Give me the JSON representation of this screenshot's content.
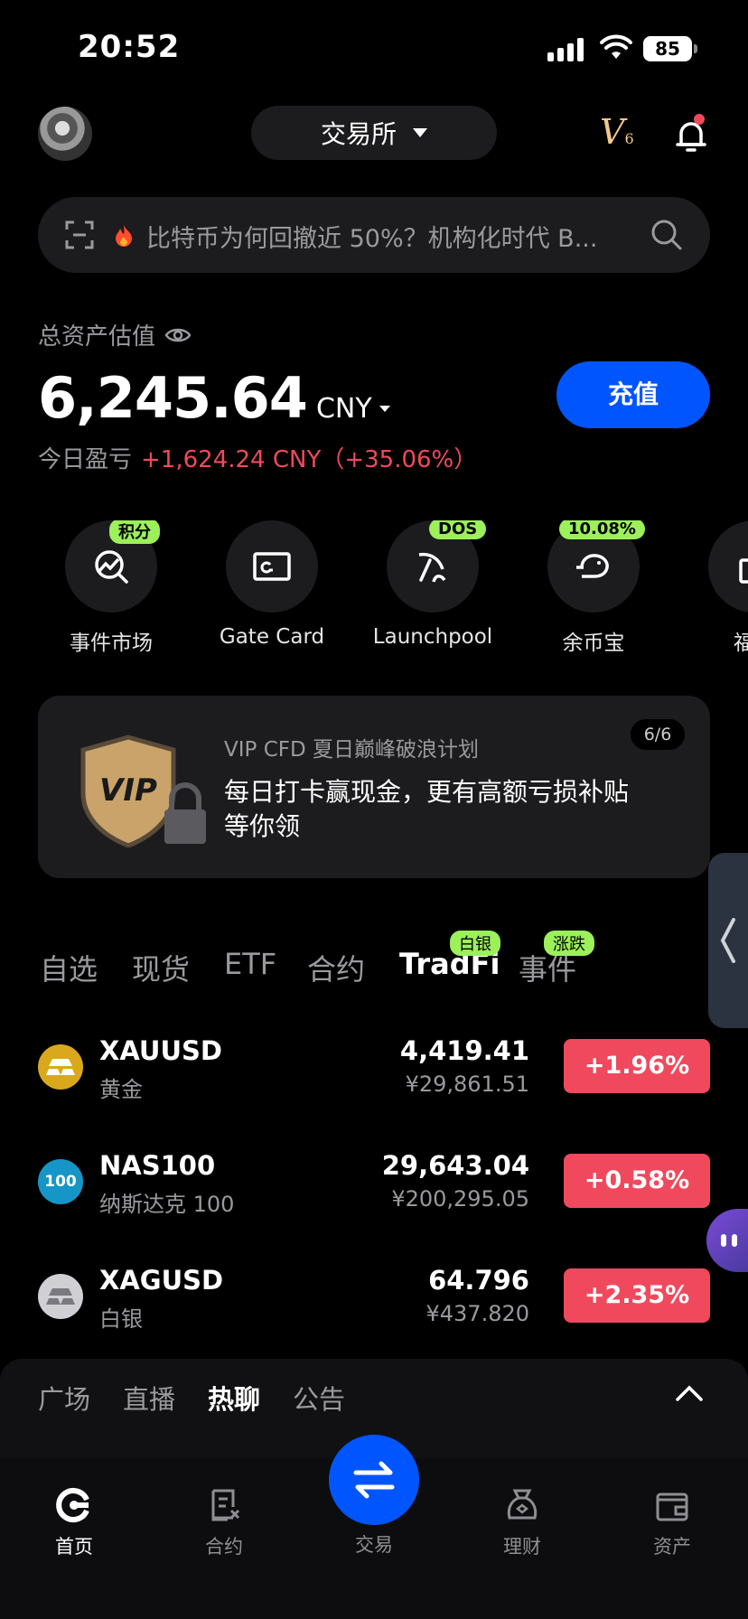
{
  "status_bar": {
    "time": "20:52",
    "battery": "85"
  },
  "header": {
    "exchange_label": "交易所",
    "vip_level": "V",
    "vip_level_num": "6"
  },
  "search": {
    "text": "比特币为何回撤近 50%？机构化时代 B..."
  },
  "assets": {
    "label": "总资产估值",
    "value": "6,245.64",
    "currency": "CNY",
    "deposit_label": "充值",
    "pnl_label": "今日盈亏",
    "pnl_value": "+1,624.24 CNY（+35.06%）"
  },
  "shortcuts": [
    {
      "label": "事件市场",
      "badge": "积分",
      "icon": "event-market-icon"
    },
    {
      "label": "Gate Card",
      "badge": "",
      "icon": "card-icon"
    },
    {
      "label": "Launchpool",
      "badge": "DOS",
      "icon": "launchpool-icon"
    },
    {
      "label": "余币宝",
      "badge": "10.08%",
      "icon": "piggy-bank-icon"
    },
    {
      "label": "福利",
      "badge": "",
      "icon": "gift-icon"
    }
  ],
  "promo": {
    "subtitle": "VIP CFD 夏日巅峰破浪计划",
    "title": "每日打卡赢现金，更有高额亏损补贴等你领",
    "page": "6/6",
    "art_text": "VIP"
  },
  "market_tabs": [
    {
      "label": "自选",
      "badge": ""
    },
    {
      "label": "现货",
      "badge": ""
    },
    {
      "label": "ETF",
      "badge": ""
    },
    {
      "label": "合约",
      "badge": ""
    },
    {
      "label": "TradFi",
      "badge": "白银",
      "active": true
    },
    {
      "label": "事件",
      "badge": "涨跌"
    }
  ],
  "markets": [
    {
      "symbol": "XAUUSD",
      "name": "黄金",
      "price": "4,419.41",
      "price_cny": "¥29,861.51",
      "change": "+1.96%",
      "logo_text": "",
      "logo_color": "#d9a81c"
    },
    {
      "symbol": "NAS100",
      "name": "纳斯达克 100",
      "price": "29,643.04",
      "price_cny": "¥200,295.05",
      "change": "+0.58%",
      "logo_text": "100",
      "logo_color": "#1696c7"
    },
    {
      "symbol": "XAGUSD",
      "name": "白银",
      "price": "64.796",
      "price_cny": "¥437.820",
      "change": "+2.35%",
      "logo_text": "",
      "logo_color": "#cfcfd4"
    }
  ],
  "feed_tabs": [
    "广场",
    "直播",
    "热聊",
    "公告"
  ],
  "tabbar": {
    "home": "首页",
    "futures": "合约",
    "trade": "交易",
    "earn": "理财",
    "assets": "资产"
  },
  "colors": {
    "accent": "#0055ff",
    "up": "#f0495d",
    "badge": "#9cf05a",
    "vip": "#f2c98a"
  }
}
